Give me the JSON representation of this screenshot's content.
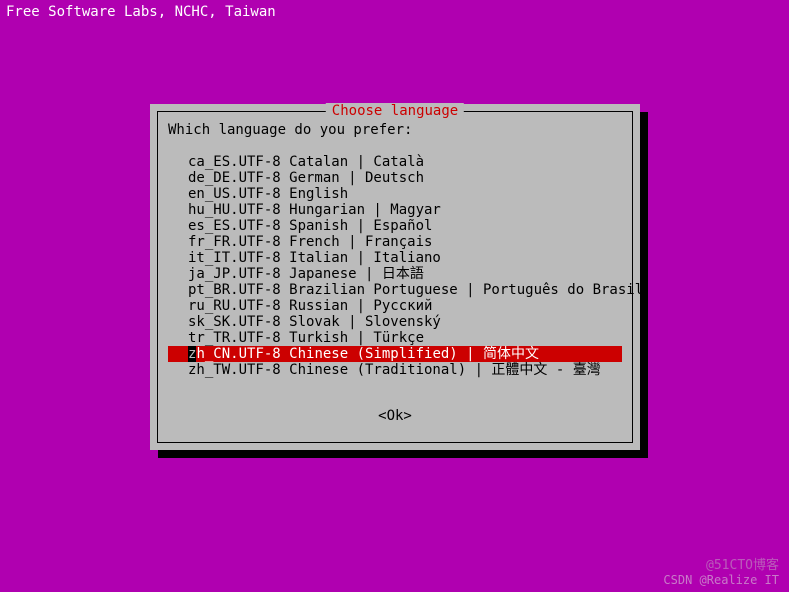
{
  "header": "Free Software Labs, NCHC, Taiwan",
  "dialog": {
    "title": "Choose language",
    "prompt": "Which language do you prefer:",
    "selected_index": 12,
    "items": [
      "ca_ES.UTF-8 Catalan | Català",
      "de_DE.UTF-8 German | Deutsch",
      "en_US.UTF-8 English",
      "hu_HU.UTF-8 Hungarian | Magyar",
      "es_ES.UTF-8 Spanish | Español",
      "fr_FR.UTF-8 French | Français",
      "it_IT.UTF-8 Italian | Italiano",
      "ja_JP.UTF-8 Japanese | 日本語",
      "pt_BR.UTF-8 Brazilian Portuguese | Português do Brasil",
      "ru_RU.UTF-8 Russian | Русский",
      "sk_SK.UTF-8 Slovak | Slovenský",
      "tr_TR.UTF-8 Turkish | Türkçe",
      "zh_CN.UTF-8 Chinese (Simplified) | 简体中文",
      "zh_TW.UTF-8 Chinese (Traditional) | 正體中文 - 臺灣"
    ],
    "ok_label": "<Ok>"
  },
  "watermark1": "@51CTO博客",
  "watermark2": "CSDN @Realize IT"
}
